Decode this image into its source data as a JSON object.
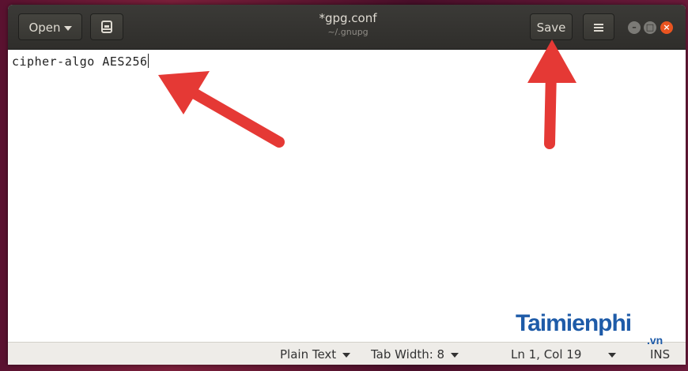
{
  "toolbar": {
    "open_label": "Open",
    "save_label": "Save",
    "title": "*gpg.conf",
    "subtitle": "~/.gnupg"
  },
  "editor": {
    "line1": "cipher-algo AES256"
  },
  "statusbar": {
    "language": "Plain Text",
    "tab_width": "Tab Width: 8",
    "position": "Ln 1, Col 19",
    "mode": "INS"
  },
  "watermark": {
    "main": "Taimienphi",
    "sub": ".vn"
  },
  "colors": {
    "arrow": "#e53935",
    "accent": "#e95420",
    "titlebar": "#3b3a37"
  },
  "icons": {
    "recent": "clipboard-icon",
    "menu": "hamburger-icon"
  }
}
